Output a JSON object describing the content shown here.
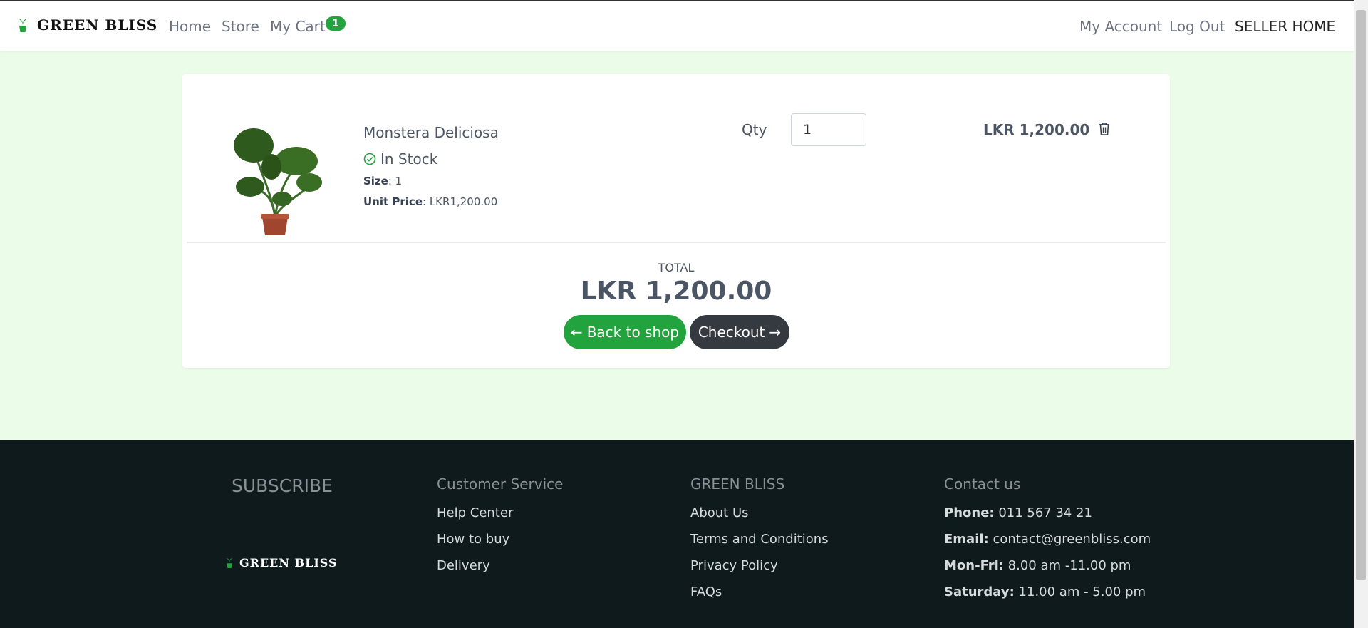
{
  "nav": {
    "brand": "GREEN BLISS",
    "home": "Home",
    "store": "Store",
    "cart": "My Cart",
    "cart_count": "1",
    "account": "My Account",
    "logout": "Log Out",
    "seller": "SELLER HOME"
  },
  "cart": {
    "item": {
      "name": "Monstera Deliciosa",
      "stock": "In Stock",
      "size_label": "Size",
      "size_value": ": 1",
      "unit_label": "Unit Price",
      "unit_value": ": LKR1,200.00",
      "qty_label": "Qty",
      "qty_value": "1",
      "line_price": "LKR 1,200.00"
    },
    "total_label": "TOTAL",
    "total_value": "LKR 1,200.00",
    "back_label": "Back to shop",
    "checkout_label": "Checkout"
  },
  "footer": {
    "subscribe": "SUBSCRIBE",
    "brand": "GREEN BLISS",
    "cs_title": "Customer Service",
    "cs_links": [
      "Help Center",
      "How to buy",
      "Delivery"
    ],
    "gb_title": "GREEN BLISS",
    "gb_links": [
      "About Us",
      "Terms and Conditions",
      "Privacy Policy",
      "FAQs"
    ],
    "contact_title": "Contact us",
    "contact": [
      {
        "label": "Phone:",
        "value": " 011 567 34 21"
      },
      {
        "label": "Email:",
        "value": " contact@greenbliss.com"
      },
      {
        "label": "Mon-Fri:",
        "value": " 8.00 am -11.00 pm"
      },
      {
        "label": "Saturday:",
        "value": " 11.00 am - 5.00 pm"
      }
    ]
  },
  "colors": {
    "brand_green": "#22a33d",
    "dark_button": "#343a40",
    "page_bg": "#ebfde8",
    "footer_bg": "#0e1a1c"
  }
}
